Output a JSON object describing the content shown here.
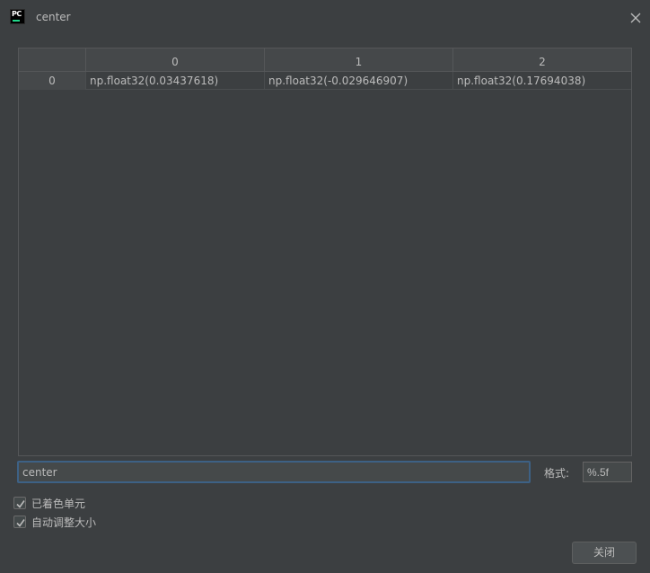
{
  "window": {
    "title": "center",
    "app_icon_text": "PC"
  },
  "table": {
    "column_headers": [
      "0",
      "1",
      "2"
    ],
    "rows": [
      {
        "index": "0",
        "cells": [
          "np.float32(0.03437618)",
          "np.float32(-0.029646907)",
          "np.float32(0.17694038)"
        ]
      }
    ]
  },
  "expression_input": {
    "value": "center"
  },
  "format": {
    "label": "格式:",
    "value": "%.5f"
  },
  "options": [
    {
      "label": "已着色单元",
      "checked": true
    },
    {
      "label": "自动调整大小",
      "checked": true
    }
  ],
  "buttons": {
    "close_label": "关闭"
  },
  "colors": {
    "background": "#3c3f41",
    "header_bg": "#45484a",
    "focus_border": "#3d6185",
    "text": "#bbbbbb"
  }
}
